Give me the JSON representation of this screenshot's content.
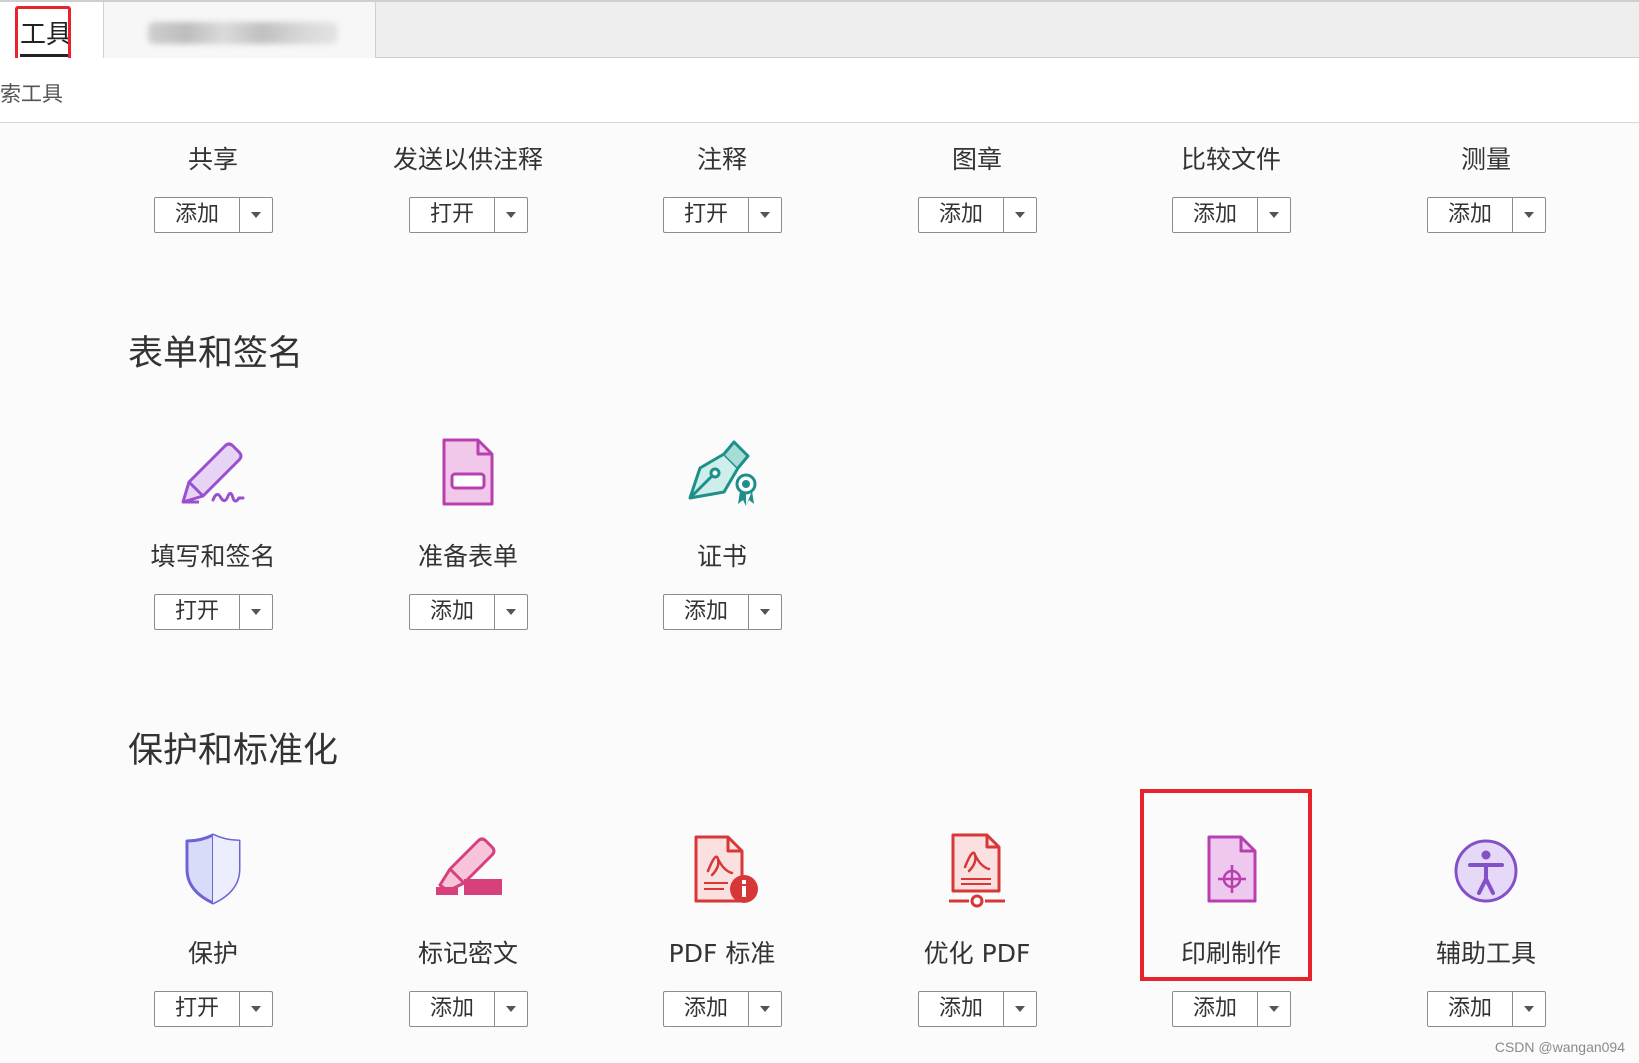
{
  "tabs": {
    "tools_label": "工具"
  },
  "search": {
    "label": "索工具"
  },
  "top_tools": [
    {
      "name": "共享",
      "button": "添加"
    },
    {
      "name": "发送以供注释",
      "button": "打开"
    },
    {
      "name": "注释",
      "button": "打开"
    },
    {
      "name": "图章",
      "button": "添加"
    },
    {
      "name": "比较文件",
      "button": "添加"
    },
    {
      "name": "测量",
      "button": "添加"
    }
  ],
  "sections": [
    {
      "title": "表单和签名",
      "tools": [
        {
          "name": "填写和签名",
          "button": "打开",
          "icon": "fill-sign-icon"
        },
        {
          "name": "准备表单",
          "button": "添加",
          "icon": "prepare-form-icon"
        },
        {
          "name": "证书",
          "button": "添加",
          "icon": "certificate-icon"
        }
      ]
    },
    {
      "title": "保护和标准化",
      "tools": [
        {
          "name": "保护",
          "button": "打开",
          "icon": "shield-icon"
        },
        {
          "name": "标记密文",
          "button": "添加",
          "icon": "redact-icon"
        },
        {
          "name": "PDF 标准",
          "button": "添加",
          "icon": "pdf-standards-icon"
        },
        {
          "name": "优化 PDF",
          "button": "添加",
          "icon": "optimize-pdf-icon"
        },
        {
          "name": "印刷制作",
          "button": "添加",
          "icon": "print-production-icon"
        },
        {
          "name": "辅助工具",
          "button": "添加",
          "icon": "accessibility-icon"
        }
      ]
    }
  ],
  "colors": {
    "highlight_red": "#e8232b",
    "purple": "#9a4fd1",
    "magenta": "#d6407d",
    "teal": "#1f8f8a",
    "red": "#d83737",
    "background": "#fbfbfb"
  },
  "watermark": "CSDN @wangan094"
}
